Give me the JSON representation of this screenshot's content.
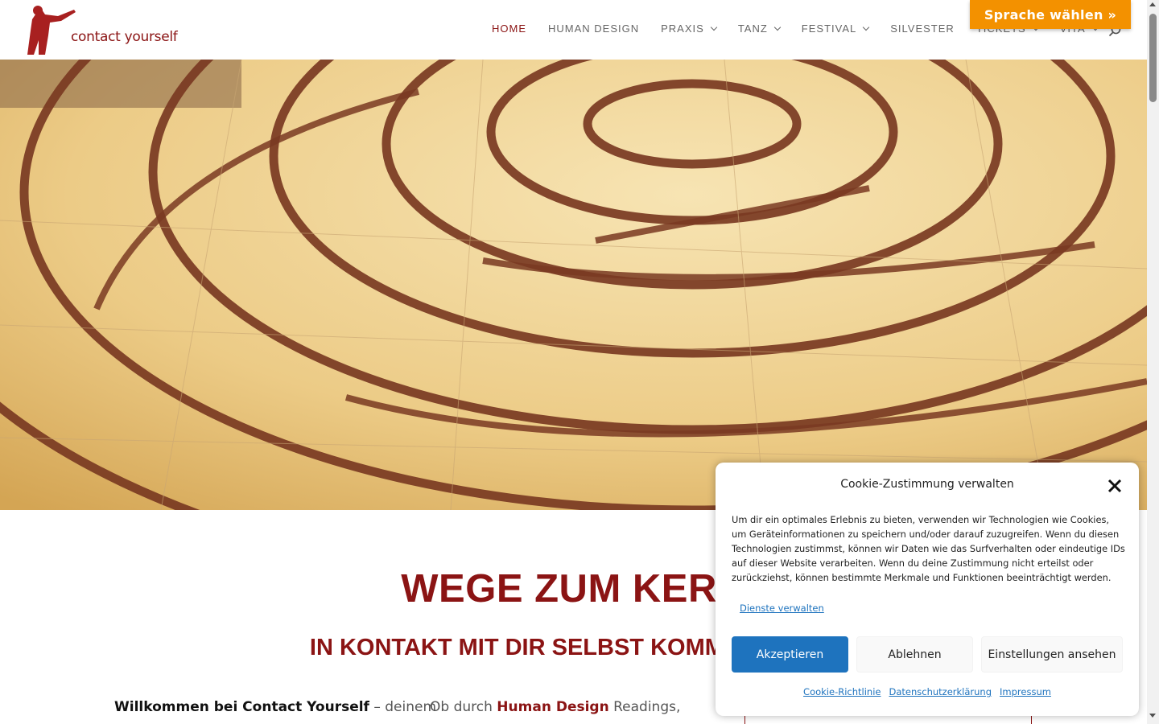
{
  "header": {
    "logo_text": "contact yourself",
    "nav": [
      {
        "label": "HOME",
        "dropdown": false,
        "active": true
      },
      {
        "label": "HUMAN DESIGN",
        "dropdown": false
      },
      {
        "label": "PRAXIS",
        "dropdown": true
      },
      {
        "label": "TANZ",
        "dropdown": true
      },
      {
        "label": "FESTIVAL",
        "dropdown": true
      },
      {
        "label": "SILVESTER",
        "dropdown": false
      },
      {
        "label": "TICKETS",
        "dropdown": true
      },
      {
        "label": "VITA",
        "dropdown": true
      }
    ],
    "search_icon": "search-icon",
    "language_button": "Sprache wählen »"
  },
  "hero": {
    "image": "stone labyrinth floor"
  },
  "content": {
    "title": "WEGE ZUM KERN",
    "subtitle": "IN KONTAKT MIT DIR SELBST KOMMEN. ECHT.",
    "col1_bold": "Willkommen bei Contact Yourself",
    "col1_rest": " – deinem",
    "col2_pre": "Ob durch ",
    "col2_bold": "Human Design",
    "col2_post": " Readings,"
  },
  "cookie": {
    "title": "Cookie-Zustimmung verwalten",
    "body": "Um dir ein optimales Erlebnis zu bieten, verwenden wir Technologien wie Cookies, um Geräteinformationen zu speichern und/oder darauf zuzugreifen. Wenn du diesen Technologien zustimmst, können wir Daten wie das Surfverhalten oder eindeutige IDs auf dieser Website verarbeiten. Wenn du deine Zustimmung nicht erteilst oder zurückziehst, können bestimmte Merkmale und Funktionen beeinträchtigt werden.",
    "manage_link": "Dienste verwalten",
    "accept": "Akzeptieren",
    "deny": "Ablehnen",
    "settings": "Einstellungen ansehen",
    "links": [
      "Cookie-Richtlinie",
      "Datenschutzerklärung",
      "Impressum"
    ]
  },
  "colors": {
    "brand_red": "#8b1414",
    "accent_orange": "#f39100",
    "link_blue": "#1e73be"
  }
}
